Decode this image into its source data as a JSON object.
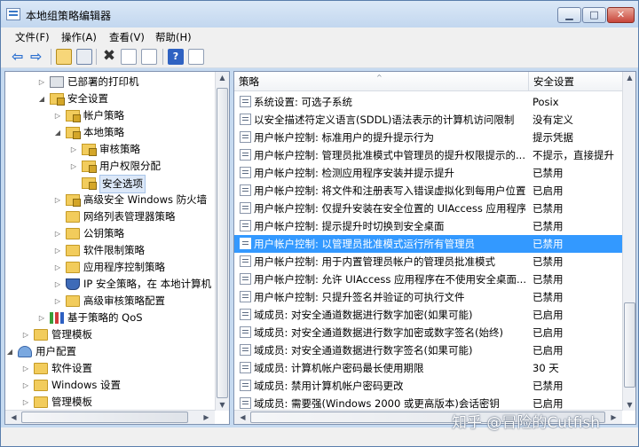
{
  "window": {
    "title": "本地组策略编辑器",
    "minimize_label": "▁",
    "maximize_label": "□",
    "close_label": "✕"
  },
  "menu": [
    "文件(F)",
    "操作(A)",
    "查看(V)",
    "帮助(H)"
  ],
  "toolbar": {
    "back_label": "⇦",
    "forward_label": "⇨",
    "delete_label": "✖",
    "help_label": "?"
  },
  "tree": [
    {
      "label": "已部署的打印机",
      "icon": "printer-icon",
      "expander": "▷",
      "level": 3
    },
    {
      "label": "安全设置",
      "icon": "folder-lock-icon",
      "expander": "◢",
      "level": 3
    },
    {
      "label": "帐户策略",
      "icon": "folder-lock-icon",
      "expander": "▷",
      "level": 4
    },
    {
      "label": "本地策略",
      "icon": "folder-lock-icon",
      "expander": "◢",
      "level": 4
    },
    {
      "label": "审核策略",
      "icon": "folder-lock-icon",
      "expander": "▷",
      "level": 5
    },
    {
      "label": "用户权限分配",
      "icon": "folder-lock-icon",
      "expander": "▷",
      "level": 5
    },
    {
      "label": "安全选项",
      "icon": "folder-lock-icon",
      "expander": "",
      "level": 5,
      "selected": true
    },
    {
      "label": "高级安全 Windows 防火墙",
      "icon": "folder-lock-icon",
      "expander": "▷",
      "level": 4
    },
    {
      "label": "网络列表管理器策略",
      "icon": "folder-icon",
      "expander": "",
      "level": 4
    },
    {
      "label": "公钥策略",
      "icon": "folder-icon",
      "expander": "▷",
      "level": 4
    },
    {
      "label": "软件限制策略",
      "icon": "folder-icon",
      "expander": "▷",
      "level": 4
    },
    {
      "label": "应用程序控制策略",
      "icon": "folder-icon",
      "expander": "▷",
      "level": 4
    },
    {
      "label": "IP 安全策略，在 本地计算机",
      "icon": "shield-icon",
      "expander": "▷",
      "level": 4
    },
    {
      "label": "高级审核策略配置",
      "icon": "folder-icon",
      "expander": "▷",
      "level": 4
    },
    {
      "label": "基于策略的 QoS",
      "icon": "qos-icon",
      "expander": "▷",
      "level": 3
    },
    {
      "label": "管理模板",
      "icon": "folder-icon",
      "expander": "▷",
      "level": 2
    },
    {
      "label": "用户配置",
      "icon": "user-config-icon",
      "expander": "◢",
      "level": 1
    },
    {
      "label": "软件设置",
      "icon": "folder-icon",
      "expander": "▷",
      "level": 2
    },
    {
      "label": "Windows 设置",
      "icon": "folder-icon",
      "expander": "▷",
      "level": 2
    },
    {
      "label": "管理模板",
      "icon": "folder-icon",
      "expander": "▷",
      "level": 2
    }
  ],
  "list": {
    "columns": [
      "策略",
      "安全设置"
    ],
    "sort_glyph": "^",
    "rows": [
      {
        "policy": "系统设置: 可选子系统",
        "setting": "Posix"
      },
      {
        "policy": "以安全描述符定义语言(SDDL)语法表示的计算机访问限制",
        "setting": "没有定义"
      },
      {
        "policy": "用户帐户控制: 标准用户的提升提示行为",
        "setting": "提示凭据"
      },
      {
        "policy": "用户帐户控制: 管理员批准模式中管理员的提升权限提示的...",
        "setting": "不提示，直接提升"
      },
      {
        "policy": "用户帐户控制: 检测应用程序安装并提示提升",
        "setting": "已禁用"
      },
      {
        "policy": "用户帐户控制: 将文件和注册表写入错误虚拟化到每用户位置",
        "setting": "已启用"
      },
      {
        "policy": "用户帐户控制: 仅提升安装在安全位置的 UIAccess 应用程序",
        "setting": "已禁用"
      },
      {
        "policy": "用户帐户控制: 提示提升时切换到安全桌面",
        "setting": "已禁用"
      },
      {
        "policy": "用户帐户控制: 以管理员批准模式运行所有管理员",
        "setting": "已禁用",
        "selected": true
      },
      {
        "policy": "用户帐户控制: 用于内置管理员帐户的管理员批准模式",
        "setting": "已禁用"
      },
      {
        "policy": "用户帐户控制: 允许 UIAccess 应用程序在不使用安全桌面...",
        "setting": "已禁用"
      },
      {
        "policy": "用户帐户控制: 只提升签名并验证的可执行文件",
        "setting": "已禁用"
      },
      {
        "policy": "域成员: 对安全通道数据进行数字加密(如果可能)",
        "setting": "已启用"
      },
      {
        "policy": "域成员: 对安全通道数据进行数字加密或数字签名(始终)",
        "setting": "已启用"
      },
      {
        "policy": "域成员: 对安全通道数据进行数字签名(如果可能)",
        "setting": "已启用"
      },
      {
        "policy": "域成员: 计算机帐户密码最长使用期限",
        "setting": "30 天"
      },
      {
        "policy": "域成员: 禁用计算机帐户密码更改",
        "setting": "已禁用"
      },
      {
        "policy": "域成员: 需要强(Windows 2000 或更高版本)会话密钥",
        "setting": "已启用"
      }
    ]
  },
  "scroll": {
    "up": "▲",
    "down": "▼",
    "left": "◀",
    "right": "▶"
  },
  "watermark": "知乎 @冒险的Cutfish"
}
